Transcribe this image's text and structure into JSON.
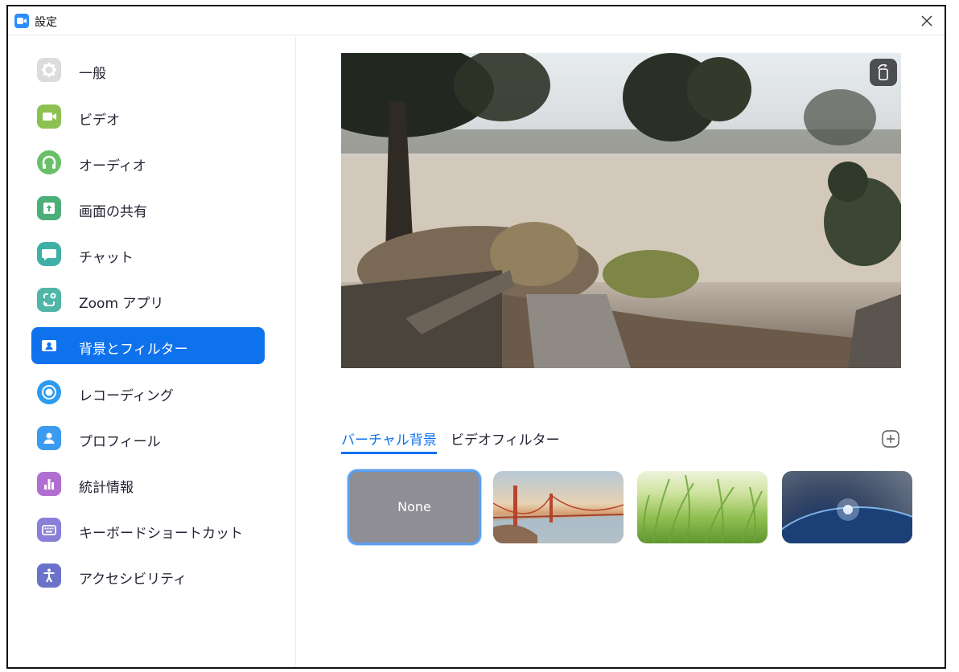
{
  "window": {
    "title": "設定"
  },
  "sidebar": {
    "items": [
      {
        "id": "general",
        "label": "一般",
        "icon": "gear-icon",
        "color": "#dcdcdc",
        "active": false
      },
      {
        "id": "video",
        "label": "ビデオ",
        "icon": "video-camera-icon",
        "color": "#8cc152",
        "active": false
      },
      {
        "id": "audio",
        "label": "オーディオ",
        "icon": "headphones-icon",
        "color": "#6abf69",
        "active": false
      },
      {
        "id": "share",
        "label": "画面の共有",
        "icon": "share-screen-icon",
        "color": "#4caf7a",
        "active": false
      },
      {
        "id": "chat",
        "label": "チャット",
        "icon": "chat-bubble-icon",
        "color": "#3fb0a6",
        "active": false
      },
      {
        "id": "apps",
        "label": "Zoom アプリ",
        "icon": "apps-icon",
        "color": "#4fb6a8",
        "active": false
      },
      {
        "id": "background",
        "label": "背景とフィルター",
        "icon": "person-card-icon",
        "color": "#0e72ed",
        "active": true
      },
      {
        "id": "recording",
        "label": "レコーディング",
        "icon": "record-icon",
        "color": "#2d9cf0",
        "active": false
      },
      {
        "id": "profile",
        "label": "プロフィール",
        "icon": "profile-icon",
        "color": "#3b9bf0",
        "active": false
      },
      {
        "id": "statistics",
        "label": "統計情報",
        "icon": "bar-chart-icon",
        "color": "#b06fd0",
        "active": false
      },
      {
        "id": "shortcuts",
        "label": "キーボードショートカット",
        "icon": "keyboard-icon",
        "color": "#8a7fd6",
        "active": false
      },
      {
        "id": "accessibility",
        "label": "アクセシビリティ",
        "icon": "accessibility-icon",
        "color": "#6b72c9",
        "active": false
      }
    ]
  },
  "main": {
    "tabs": {
      "virtual_background": "バーチャル背景",
      "video_filter": "ビデオフィルター"
    },
    "thumbnails": {
      "none_label": "None"
    }
  },
  "colors": {
    "accent": "#0e72ed",
    "selected_outline": "#5aa0f2"
  }
}
